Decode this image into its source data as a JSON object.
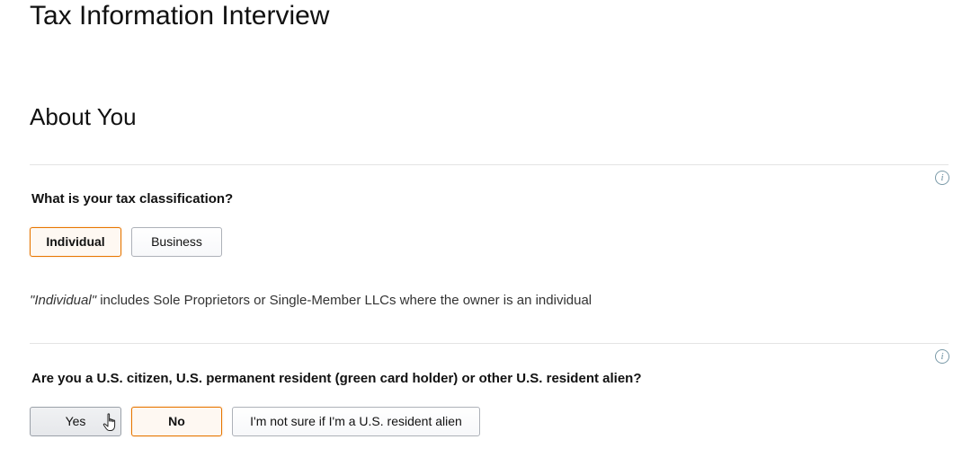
{
  "page": {
    "title": "Tax Information Interview"
  },
  "section": {
    "title": "About You"
  },
  "tax_classification": {
    "question": "What is your tax classification?",
    "options": [
      {
        "label": "Individual",
        "selected": true
      },
      {
        "label": "Business",
        "selected": false
      }
    ],
    "note_emphasis": "\"Individual\"",
    "note_rest": " includes Sole Proprietors or Single-Member LLCs where the owner is an individual",
    "info_icon": "info-icon"
  },
  "us_person": {
    "question": "Are you a U.S. citizen, U.S. permanent resident (green card holder) or other U.S. resident alien?",
    "options": [
      {
        "label": "Yes",
        "selected": false,
        "hovered": true
      },
      {
        "label": "No",
        "selected": true
      },
      {
        "label": "I'm not sure if I'm a U.S. resident alien",
        "selected": false
      }
    ],
    "info_icon": "info-icon"
  },
  "colors": {
    "selected_border": "#e77600",
    "selected_background": "#fef8f2",
    "info_icon": "#6c8f9f",
    "divider": "#e4e4e4"
  },
  "cursor": "hand-pointer-icon"
}
